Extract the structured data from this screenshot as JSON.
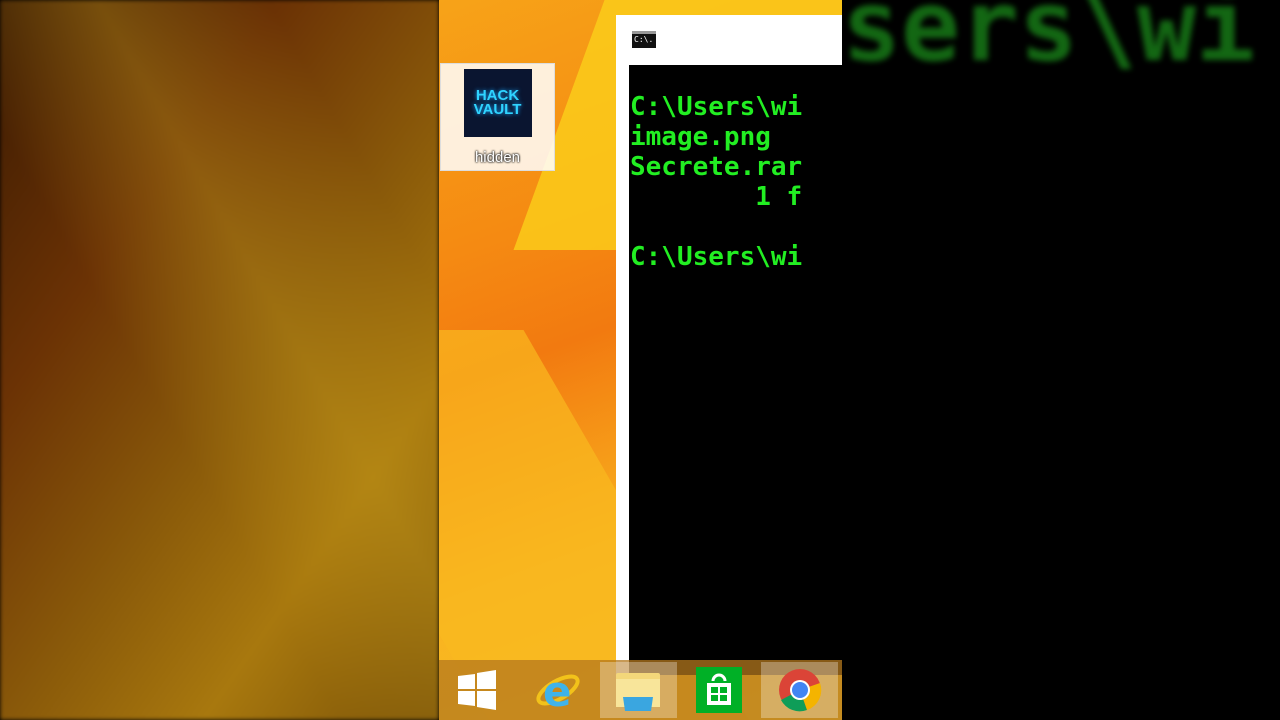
{
  "desktop": {
    "icon_label": "hidden",
    "icon_thumb_line1": "HACK",
    "icon_thumb_line2": "VAULT"
  },
  "terminal": {
    "title_icon": "C:\\.",
    "lines": [
      "C:\\Users\\wi",
      "image.png",
      "Secrete.rar",
      "        1 f",
      "",
      "C:\\Users\\wi"
    ]
  },
  "background_text": "sers\\wi",
  "taskbar": {
    "items": [
      "start",
      "internet-explorer",
      "file-explorer",
      "store",
      "chrome"
    ]
  },
  "colors": {
    "terminal_text": "#22ee22",
    "store": "#00b026"
  }
}
